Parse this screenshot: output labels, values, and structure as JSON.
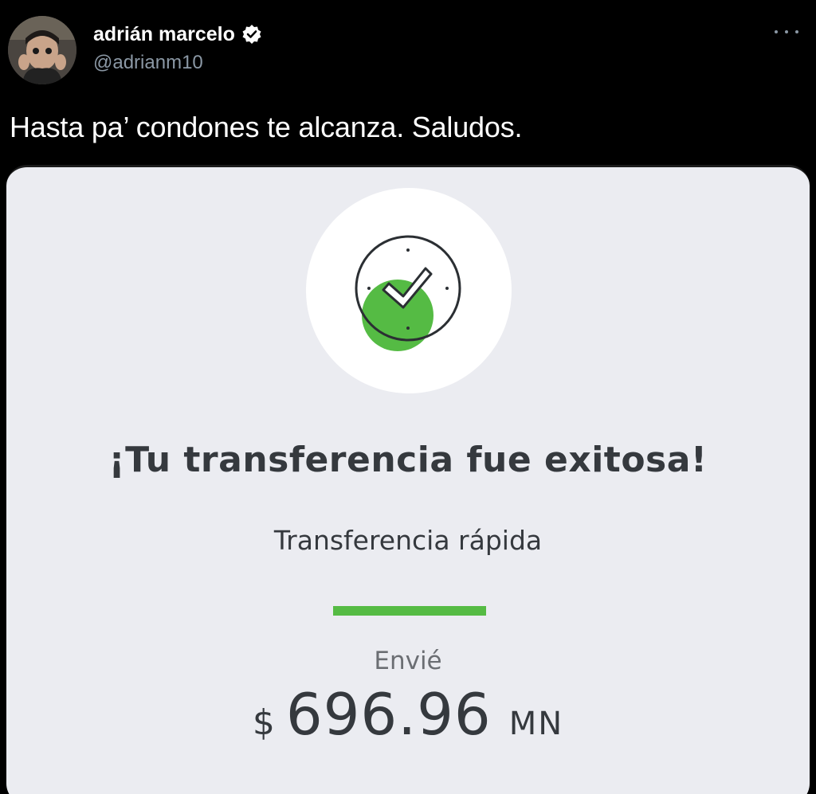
{
  "author": {
    "display_name": "adrián marcelo",
    "handle": "@adrianm10",
    "avatar_icon": "profile-photo",
    "verified_icon": "verified-badge-icon"
  },
  "tweet": {
    "text": "Hasta pa’ condones te alcanza. Saludos."
  },
  "more_icon": "more-options-icon",
  "media": {
    "status_icon": "check-circle-icon",
    "title": "¡Tu transferencia fue exitosa!",
    "transfer_type": "Transferencia rápida",
    "sent_label": "Envié",
    "currency_symbol": "$",
    "amount": "696.96",
    "currency_code": "MN"
  },
  "colors": {
    "background": "#000000",
    "card": "#ebecf1",
    "accent_green": "#55bb44",
    "text_dark": "#35393e",
    "handle_gray": "#8b98a5"
  }
}
